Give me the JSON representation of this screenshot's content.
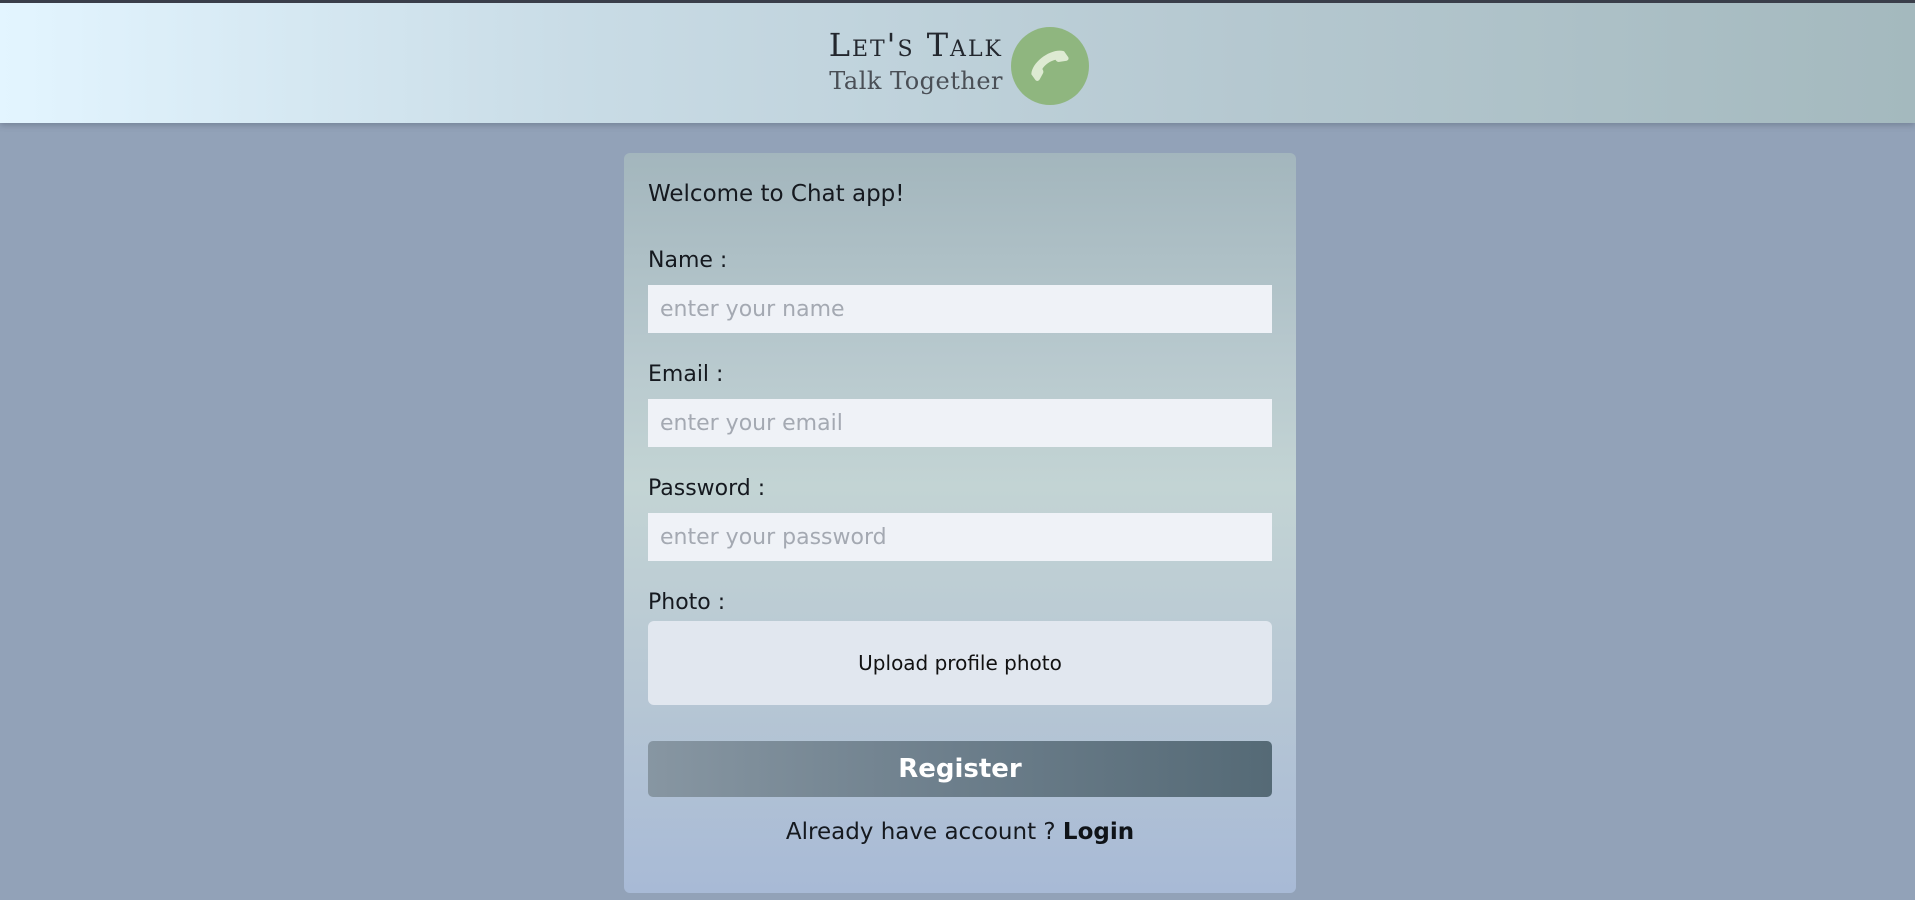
{
  "brand": {
    "title": "Let's Talk",
    "subtitle": "Talk Together",
    "logo_icon": "phone-icon",
    "logo_color": "#8fb67f"
  },
  "form": {
    "welcome": "Welcome to Chat app!",
    "name_label": "Name :",
    "name_placeholder": "enter your name",
    "email_label": "Email :",
    "email_placeholder": "enter your email",
    "password_label": "Password :",
    "password_placeholder": "enter your password",
    "photo_label": "Photo :",
    "upload_label": "Upload profile photo",
    "register_label": "Register",
    "already_text": "Already have account ?",
    "login_label": "Login"
  },
  "colors": {
    "page_background": "#92a2b8",
    "register_button": "#6c7e8b"
  }
}
